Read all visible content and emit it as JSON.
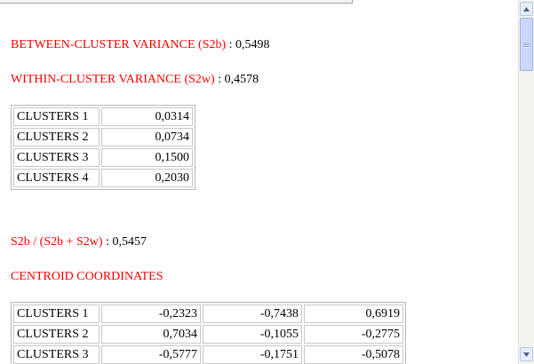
{
  "stats": {
    "between_label": "BETWEEN-CLUSTER VARIANCE (S2b)",
    "between_value": " : 0,5498",
    "within_label": "WITHIN-CLUSTER VARIANCE (S2w)",
    "within_value": " : 0,4578",
    "ratio_label": "S2b / (S2b + S2w)",
    "ratio_value": " : 0,5457"
  },
  "variance_table": {
    "rows": [
      {
        "label": "CLUSTERS 1",
        "value": "0,0314"
      },
      {
        "label": "CLUSTERS 2",
        "value": "0,0734"
      },
      {
        "label": "CLUSTERS 3",
        "value": "0,1500"
      },
      {
        "label": "CLUSTERS 4",
        "value": "0,2030"
      }
    ]
  },
  "centroid": {
    "title": "CENTROID COORDINATES",
    "rows": [
      {
        "label": "CLUSTERS 1",
        "values": [
          "-0,2323",
          "-0,7438",
          "0,6919"
        ]
      },
      {
        "label": "CLUSTERS 2",
        "values": [
          "0,7034",
          "-0,1055",
          "-0,2775"
        ]
      },
      {
        "label": "CLUSTERS 3",
        "values": [
          "-0,5777",
          "-0,1751",
          "-0,5078"
        ]
      }
    ]
  },
  "scrollbar": {
    "up_icon": "triangle-up-icon",
    "down_icon": "triangle-down-icon"
  },
  "colors": {
    "label_red": "#ff0000",
    "text": "#000000"
  }
}
